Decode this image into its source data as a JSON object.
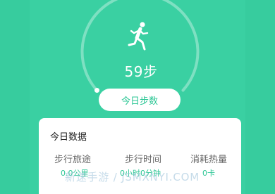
{
  "header": {
    "steps_value": "59步",
    "today_steps_button": "今日步数"
  },
  "card": {
    "title": "今日数据",
    "stats": [
      {
        "label": "步行旅途",
        "value": "0.0公里"
      },
      {
        "label": "步行时间",
        "value": "0小时0分钟"
      },
      {
        "label": "消耗热量",
        "value": "0卡"
      }
    ]
  },
  "icons": {
    "runner": "running-person-icon"
  },
  "colors": {
    "background": "#3ad0a2",
    "accent": "#2ec796",
    "card": "#ffffff"
  },
  "watermark": "新速手游 / JSMXNYI.COM"
}
